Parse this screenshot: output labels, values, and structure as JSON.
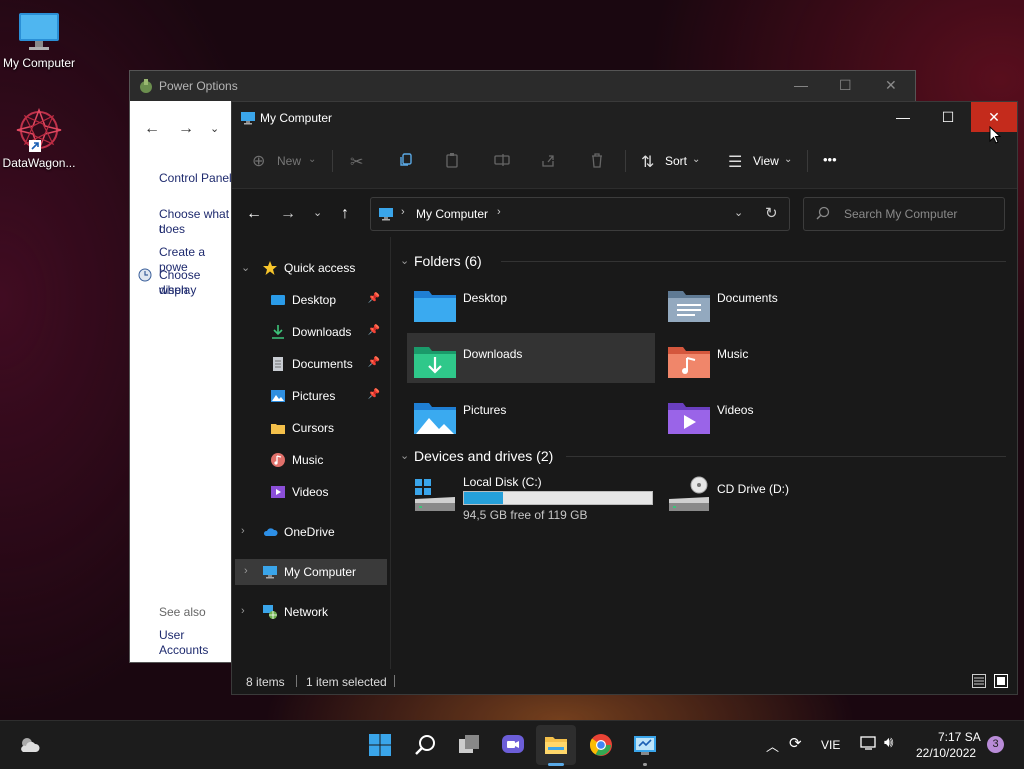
{
  "desktop": {
    "icons": [
      {
        "label": "My Computer"
      },
      {
        "label": "DataWagon..."
      }
    ]
  },
  "power_window": {
    "title": "Power Options",
    "sidebar": {
      "control_panel": "Control Panel",
      "choose_what_1": "Choose what t",
      "choose_what_2": "does",
      "create_power": "Create a powe",
      "choose_when_1": "Choose when",
      "choose_when_2": "display",
      "see_also": "See also",
      "user_accounts": "User Accounts"
    }
  },
  "explorer": {
    "title": "My Computer",
    "toolbar": {
      "new_label": "New",
      "sort_label": "Sort",
      "view_label": "View",
      "more_label": "•••"
    },
    "address": {
      "location": "My Computer",
      "search_placeholder": "Search My Computer"
    },
    "sidebar": {
      "quick_access": "Quick access",
      "items": [
        {
          "label": "Desktop",
          "pinned": true
        },
        {
          "label": "Downloads",
          "pinned": true
        },
        {
          "label": "Documents",
          "pinned": true
        },
        {
          "label": "Pictures",
          "pinned": true
        },
        {
          "label": "Cursors",
          "pinned": false
        },
        {
          "label": "Music",
          "pinned": false
        },
        {
          "label": "Videos",
          "pinned": false
        }
      ],
      "onedrive": "OneDrive",
      "my_computer": "My Computer",
      "network": "Network"
    },
    "folders_header": "Folders (6)",
    "folders": [
      {
        "label": "Desktop"
      },
      {
        "label": "Documents"
      },
      {
        "label": "Downloads"
      },
      {
        "label": "Music"
      },
      {
        "label": "Pictures"
      },
      {
        "label": "Videos"
      }
    ],
    "devices_header": "Devices and drives (2)",
    "drives": [
      {
        "label": "Local Disk (C:)",
        "free_text": "94,5 GB free of 119 GB",
        "used_fraction": 0.206
      },
      {
        "label": "CD Drive (D:)"
      }
    ],
    "status": {
      "items": "8 items",
      "selected": "1 item selected"
    }
  },
  "taskbar": {
    "language": "VIE",
    "time": "7:17 SA",
    "date": "22/10/2022",
    "notifications": "3"
  },
  "colors": {
    "accent": "#0078d4",
    "close_red": "#c42b1c",
    "drive_bar": "#26a0da"
  }
}
